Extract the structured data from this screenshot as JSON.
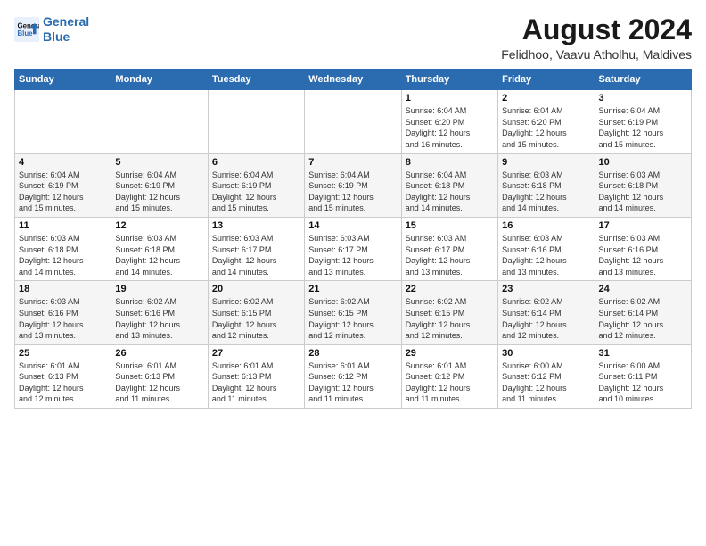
{
  "header": {
    "logo_line1": "General",
    "logo_line2": "Blue",
    "title": "August 2024",
    "subtitle": "Felidhoo, Vaavu Atholhu, Maldives"
  },
  "weekdays": [
    "Sunday",
    "Monday",
    "Tuesday",
    "Wednesday",
    "Thursday",
    "Friday",
    "Saturday"
  ],
  "weeks": [
    [
      {
        "day": "",
        "detail": ""
      },
      {
        "day": "",
        "detail": ""
      },
      {
        "day": "",
        "detail": ""
      },
      {
        "day": "",
        "detail": ""
      },
      {
        "day": "1",
        "detail": "Sunrise: 6:04 AM\nSunset: 6:20 PM\nDaylight: 12 hours\nand 16 minutes."
      },
      {
        "day": "2",
        "detail": "Sunrise: 6:04 AM\nSunset: 6:20 PM\nDaylight: 12 hours\nand 15 minutes."
      },
      {
        "day": "3",
        "detail": "Sunrise: 6:04 AM\nSunset: 6:19 PM\nDaylight: 12 hours\nand 15 minutes."
      }
    ],
    [
      {
        "day": "4",
        "detail": "Sunrise: 6:04 AM\nSunset: 6:19 PM\nDaylight: 12 hours\nand 15 minutes."
      },
      {
        "day": "5",
        "detail": "Sunrise: 6:04 AM\nSunset: 6:19 PM\nDaylight: 12 hours\nand 15 minutes."
      },
      {
        "day": "6",
        "detail": "Sunrise: 6:04 AM\nSunset: 6:19 PM\nDaylight: 12 hours\nand 15 minutes."
      },
      {
        "day": "7",
        "detail": "Sunrise: 6:04 AM\nSunset: 6:19 PM\nDaylight: 12 hours\nand 15 minutes."
      },
      {
        "day": "8",
        "detail": "Sunrise: 6:04 AM\nSunset: 6:18 PM\nDaylight: 12 hours\nand 14 minutes."
      },
      {
        "day": "9",
        "detail": "Sunrise: 6:03 AM\nSunset: 6:18 PM\nDaylight: 12 hours\nand 14 minutes."
      },
      {
        "day": "10",
        "detail": "Sunrise: 6:03 AM\nSunset: 6:18 PM\nDaylight: 12 hours\nand 14 minutes."
      }
    ],
    [
      {
        "day": "11",
        "detail": "Sunrise: 6:03 AM\nSunset: 6:18 PM\nDaylight: 12 hours\nand 14 minutes."
      },
      {
        "day": "12",
        "detail": "Sunrise: 6:03 AM\nSunset: 6:18 PM\nDaylight: 12 hours\nand 14 minutes."
      },
      {
        "day": "13",
        "detail": "Sunrise: 6:03 AM\nSunset: 6:17 PM\nDaylight: 12 hours\nand 14 minutes."
      },
      {
        "day": "14",
        "detail": "Sunrise: 6:03 AM\nSunset: 6:17 PM\nDaylight: 12 hours\nand 13 minutes."
      },
      {
        "day": "15",
        "detail": "Sunrise: 6:03 AM\nSunset: 6:17 PM\nDaylight: 12 hours\nand 13 minutes."
      },
      {
        "day": "16",
        "detail": "Sunrise: 6:03 AM\nSunset: 6:16 PM\nDaylight: 12 hours\nand 13 minutes."
      },
      {
        "day": "17",
        "detail": "Sunrise: 6:03 AM\nSunset: 6:16 PM\nDaylight: 12 hours\nand 13 minutes."
      }
    ],
    [
      {
        "day": "18",
        "detail": "Sunrise: 6:03 AM\nSunset: 6:16 PM\nDaylight: 12 hours\nand 13 minutes."
      },
      {
        "day": "19",
        "detail": "Sunrise: 6:02 AM\nSunset: 6:16 PM\nDaylight: 12 hours\nand 13 minutes."
      },
      {
        "day": "20",
        "detail": "Sunrise: 6:02 AM\nSunset: 6:15 PM\nDaylight: 12 hours\nand 12 minutes."
      },
      {
        "day": "21",
        "detail": "Sunrise: 6:02 AM\nSunset: 6:15 PM\nDaylight: 12 hours\nand 12 minutes."
      },
      {
        "day": "22",
        "detail": "Sunrise: 6:02 AM\nSunset: 6:15 PM\nDaylight: 12 hours\nand 12 minutes."
      },
      {
        "day": "23",
        "detail": "Sunrise: 6:02 AM\nSunset: 6:14 PM\nDaylight: 12 hours\nand 12 minutes."
      },
      {
        "day": "24",
        "detail": "Sunrise: 6:02 AM\nSunset: 6:14 PM\nDaylight: 12 hours\nand 12 minutes."
      }
    ],
    [
      {
        "day": "25",
        "detail": "Sunrise: 6:01 AM\nSunset: 6:13 PM\nDaylight: 12 hours\nand 12 minutes."
      },
      {
        "day": "26",
        "detail": "Sunrise: 6:01 AM\nSunset: 6:13 PM\nDaylight: 12 hours\nand 11 minutes."
      },
      {
        "day": "27",
        "detail": "Sunrise: 6:01 AM\nSunset: 6:13 PM\nDaylight: 12 hours\nand 11 minutes."
      },
      {
        "day": "28",
        "detail": "Sunrise: 6:01 AM\nSunset: 6:12 PM\nDaylight: 12 hours\nand 11 minutes."
      },
      {
        "day": "29",
        "detail": "Sunrise: 6:01 AM\nSunset: 6:12 PM\nDaylight: 12 hours\nand 11 minutes."
      },
      {
        "day": "30",
        "detail": "Sunrise: 6:00 AM\nSunset: 6:12 PM\nDaylight: 12 hours\nand 11 minutes."
      },
      {
        "day": "31",
        "detail": "Sunrise: 6:00 AM\nSunset: 6:11 PM\nDaylight: 12 hours\nand 10 minutes."
      }
    ]
  ]
}
